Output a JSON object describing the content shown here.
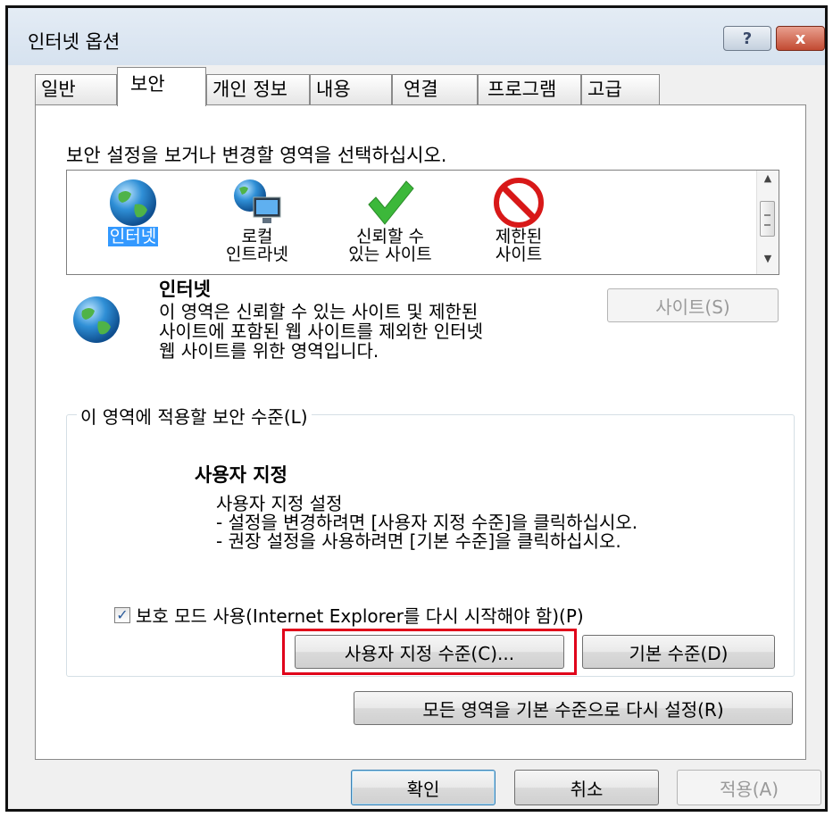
{
  "window": {
    "title": "인터넷 옵션",
    "help_label": "?",
    "close_label": "x"
  },
  "tabs": [
    {
      "label": "일반",
      "active": false
    },
    {
      "label": "보안",
      "active": true
    },
    {
      "label": "개인 정보",
      "active": false
    },
    {
      "label": "내용",
      "active": false
    },
    {
      "label": "연결",
      "active": false
    },
    {
      "label": "프로그램",
      "active": false
    },
    {
      "label": "고급",
      "active": false
    }
  ],
  "security": {
    "instruction": "보안 설정을 보거나 변경할 영역을 선택하십시오.",
    "zones": [
      {
        "label": "인터넷",
        "icon": "globe-icon",
        "selected": true
      },
      {
        "label": "로컬\n인트라넷",
        "icon": "local-intranet-icon",
        "selected": false
      },
      {
        "label": "신뢰할 수\n있는 사이트",
        "icon": "checkmark-icon",
        "selected": false
      },
      {
        "label": "제한된\n사이트",
        "icon": "restricted-icon",
        "selected": false
      }
    ],
    "selected_zone": {
      "name": "인터넷",
      "description": "이 영역은 신뢰할 수 있는 사이트 및 제한된\n사이트에 포함된 웹 사이트를 제외한 인터넷\n웹 사이트를 위한 영역입니다.",
      "sites_button": "사이트(S)"
    },
    "level_group": {
      "title": "이 영역에 적용할 보안 수준(L)",
      "level_name": "사용자 지정",
      "level_description": "사용자 지정 설정\n- 설정을 변경하려면 [사용자 지정 수준]을 클릭하십시오.\n- 권장 설정을 사용하려면 [기본 수준]을 클릭하십시오.",
      "protected_mode_label": "보호 모드 사용(Internet Explorer를 다시 시작해야 함)(P)",
      "protected_mode_checked": true,
      "custom_level_button": "사용자 지정 수준(C)...",
      "default_level_button": "기본 수준(D)"
    },
    "reset_all_button": "모든 영역을 기본 수준으로 다시 설정(R)"
  },
  "footer": {
    "ok_button": "확인",
    "cancel_button": "취소",
    "apply_button": "적용(A)"
  },
  "colors": {
    "highlight_border": "#e0001a",
    "selection": "#3399ff"
  }
}
